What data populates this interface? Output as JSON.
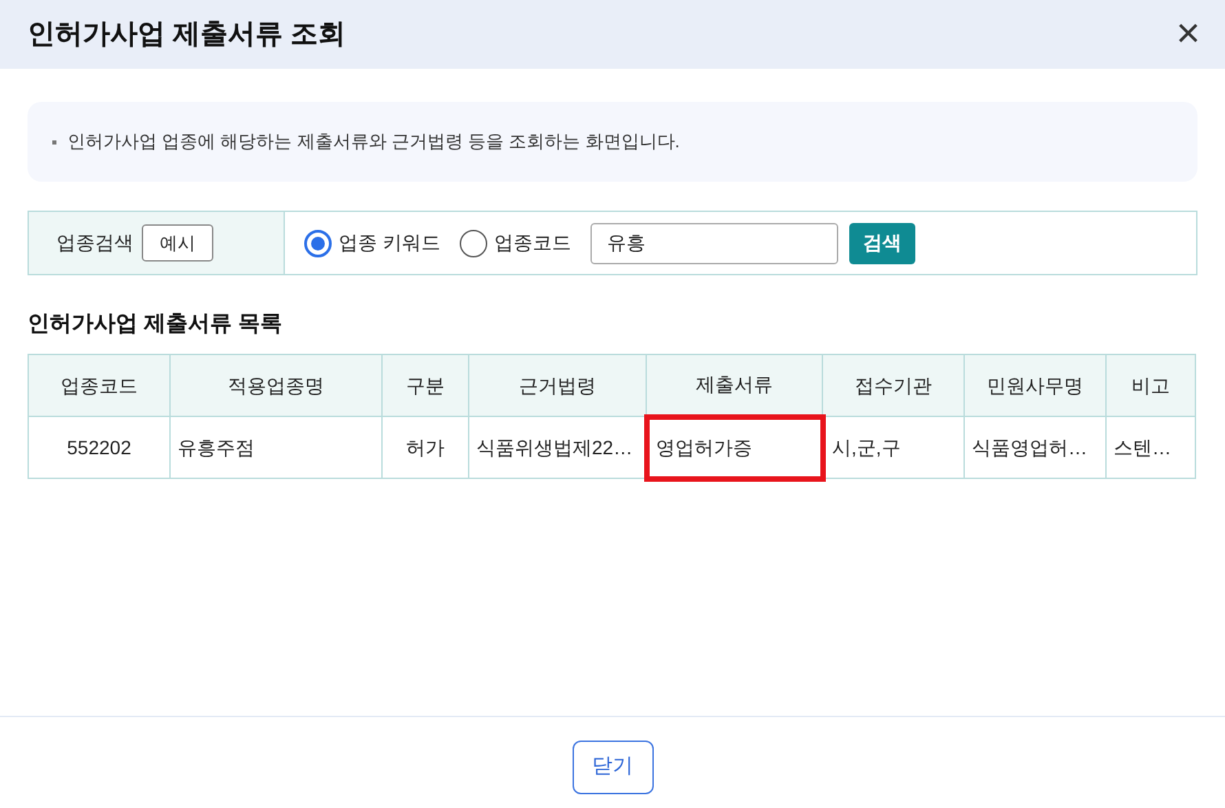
{
  "window": {
    "title": "인허가사업 제출서류 조회",
    "close": "×"
  },
  "notice": "인허가사업 업종에 해당하는 제출서류와 근거법령 등을 조회하는 화면입니다.",
  "search": {
    "label": "업종검색",
    "example_button": "예시",
    "options": [
      {
        "label": "업종 키워드",
        "selected": true
      },
      {
        "label": "업종코드",
        "selected": false
      }
    ],
    "value": "유흥",
    "button": "검색"
  },
  "list_title": "인허가사업 제출서류 목록",
  "table": {
    "columns": [
      "업종코드",
      "적용업종명",
      "구분",
      "근거법령",
      "제출서류",
      "접수기관",
      "민원사무명",
      "비고"
    ],
    "rows": [
      [
        {
          "text": "552202",
          "highlighted": false
        },
        {
          "text": "유흥주점",
          "highlighted": false
        },
        {
          "text": "허가",
          "highlighted": false
        },
        {
          "text": "식품위생법제22…",
          "highlighted": false
        },
        {
          "text": "영업허가증",
          "highlighted": true
        },
        {
          "text": "시,군,구",
          "highlighted": false
        },
        {
          "text": "식품영업허…",
          "highlighted": false
        },
        {
          "text": "스텐…",
          "highlighted": false
        }
      ]
    ]
  },
  "footer_button": "닫기"
}
